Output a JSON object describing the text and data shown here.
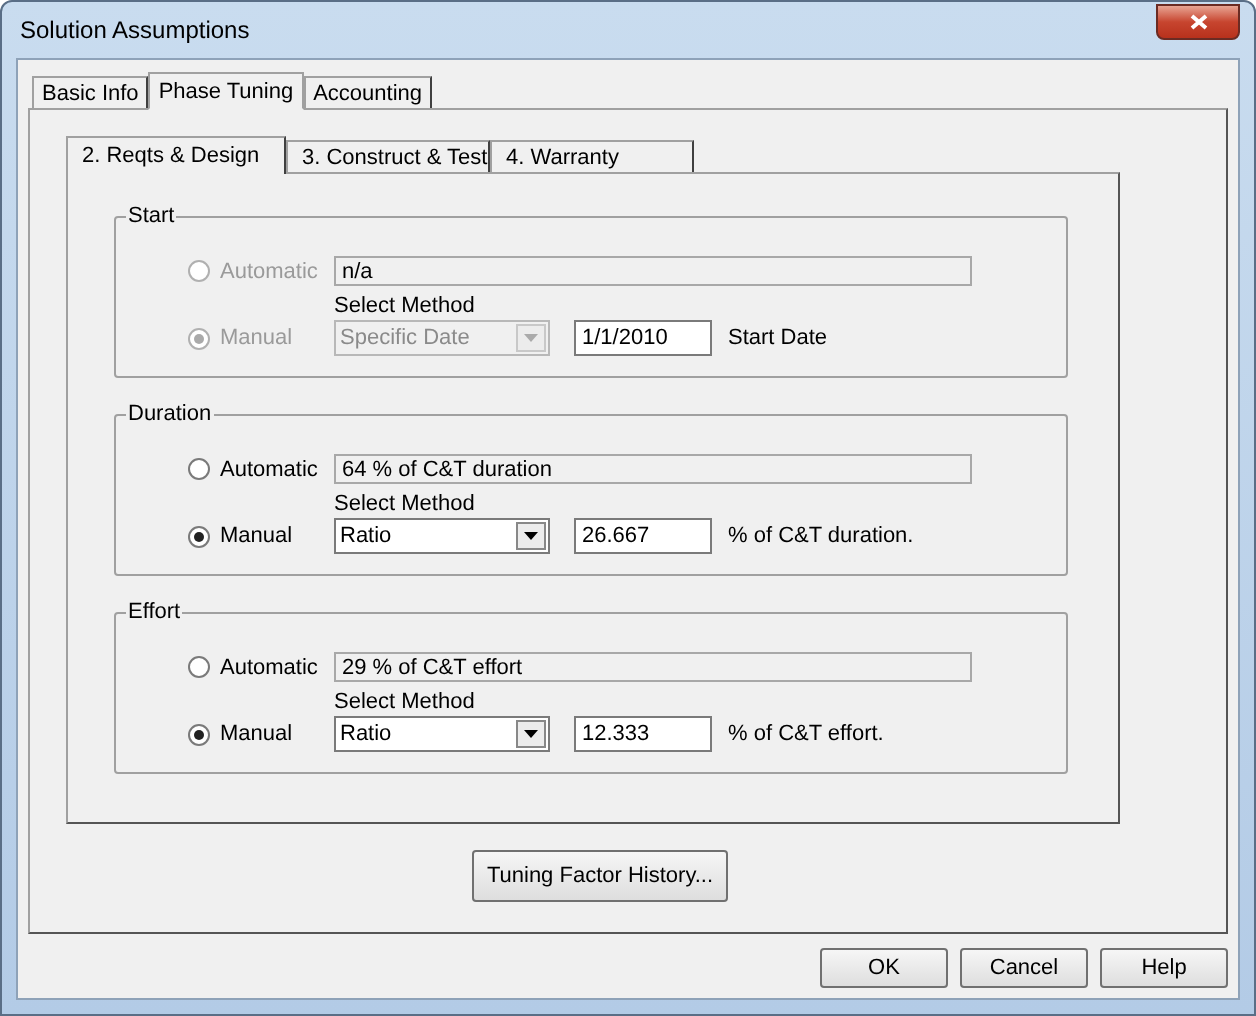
{
  "window": {
    "title": "Solution Assumptions"
  },
  "tabs": [
    {
      "label": "Basic Info",
      "selected": false
    },
    {
      "label": "Phase Tuning",
      "selected": true
    },
    {
      "label": "Accounting",
      "selected": false
    }
  ],
  "phase_tabs": [
    {
      "label": "2.  Reqts & Design",
      "selected": true
    },
    {
      "label": "3.  Construct & Test",
      "selected": false
    },
    {
      "label": "4.  Warranty",
      "selected": false
    }
  ],
  "sections": [
    {
      "title": "Start",
      "disabled": true,
      "automatic": {
        "label": "Automatic",
        "selected": false,
        "text": "n/a"
      },
      "manual": {
        "label": "Manual",
        "selected": true
      },
      "method_label": "Select Method",
      "method": "Specific Date",
      "value": "1/1/2010",
      "unit": "Start Date"
    },
    {
      "title": "Duration",
      "disabled": false,
      "automatic": {
        "label": "Automatic",
        "selected": false,
        "text": "64 % of C&T duration"
      },
      "manual": {
        "label": "Manual",
        "selected": true
      },
      "method_label": "Select Method",
      "method": "Ratio",
      "value": "26.667",
      "unit": "% of C&T duration."
    },
    {
      "title": "Effort",
      "disabled": false,
      "automatic": {
        "label": "Automatic",
        "selected": false,
        "text": "29 % of C&T effort"
      },
      "manual": {
        "label": "Manual",
        "selected": true
      },
      "method_label": "Select Method",
      "method": "Ratio",
      "value": "12.333",
      "unit": "% of C&T effort."
    }
  ],
  "history_button": "Tuning Factor History...",
  "buttons": [
    "OK",
    "Cancel",
    "Help"
  ]
}
